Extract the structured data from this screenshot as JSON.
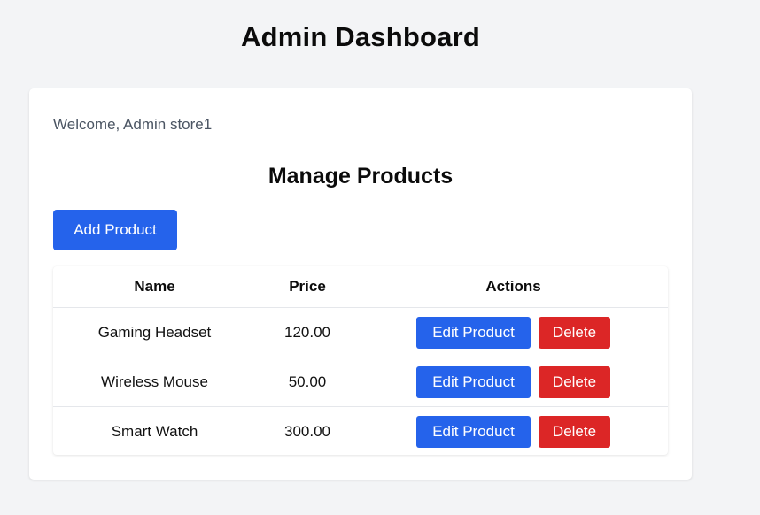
{
  "page": {
    "title": "Admin Dashboard"
  },
  "card": {
    "welcome": "Welcome, Admin store1",
    "section_title": "Manage Products",
    "add_button_label": "Add Product"
  },
  "table": {
    "headers": {
      "name": "Name",
      "price": "Price",
      "actions": "Actions"
    },
    "rows": [
      {
        "name": "Gaming Headset",
        "price": "120.00",
        "edit_label": "Edit Product",
        "delete_label": "Delete"
      },
      {
        "name": "Wireless Mouse",
        "price": "50.00",
        "edit_label": "Edit Product",
        "delete_label": "Delete"
      },
      {
        "name": "Smart Watch",
        "price": "300.00",
        "edit_label": "Edit Product",
        "delete_label": "Delete"
      }
    ]
  },
  "colors": {
    "background": "#f3f4f6",
    "primary": "#2563eb",
    "danger": "#dc2626",
    "card": "#ffffff",
    "muted_text": "#4b5563"
  }
}
